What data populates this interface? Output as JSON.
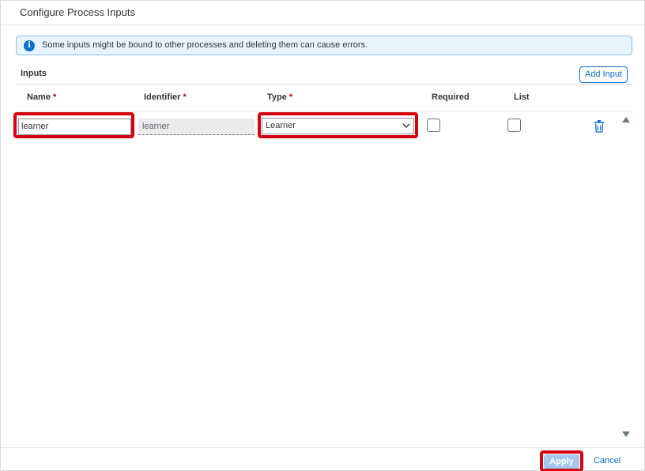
{
  "dialog": {
    "title": "Configure Process Inputs"
  },
  "info": {
    "icon": "info-icon",
    "text": "Some inputs might be bound to other processes and deleting them can cause errors."
  },
  "inputs_section": {
    "label": "Inputs",
    "add_button_label": "Add Input"
  },
  "table": {
    "columns": [
      {
        "label": "Name",
        "required_mark": "*"
      },
      {
        "label": "Identifier",
        "required_mark": "*"
      },
      {
        "label": "Type",
        "required_mark": "*"
      },
      {
        "label": "Required",
        "required_mark": ""
      },
      {
        "label": "List",
        "required_mark": ""
      }
    ],
    "rows": [
      {
        "name": "learner",
        "identifier": "learner",
        "type": "Learner",
        "required_checked": false,
        "list_checked": false,
        "delete_icon": "trash-icon"
      }
    ]
  },
  "footer": {
    "apply_label": "Apply",
    "cancel_label": "Cancel"
  },
  "colors": {
    "accent": "#0a6ed1",
    "highlight": "#d40010",
    "required_mark": "#bb0000",
    "info_background": "#e8f4fc"
  }
}
